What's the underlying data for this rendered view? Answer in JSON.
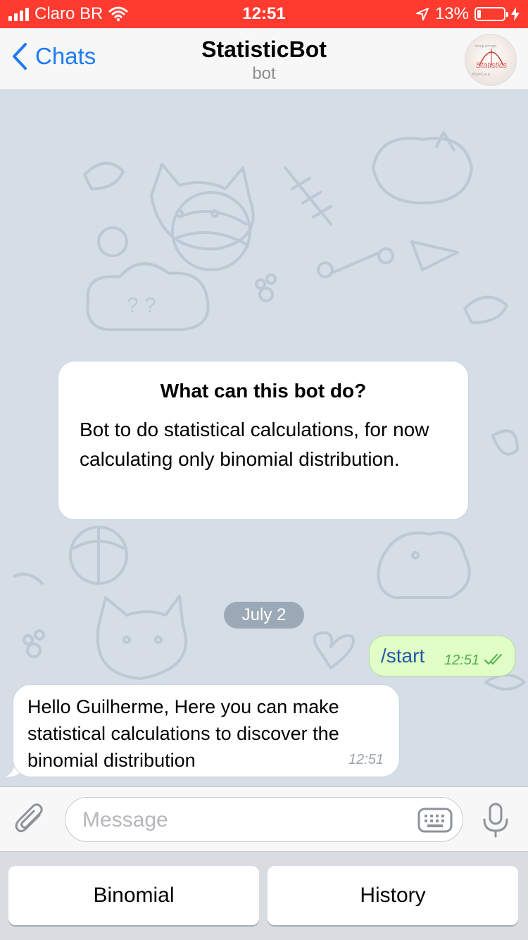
{
  "status_bar": {
    "carrier": "Claro BR",
    "time": "12:51",
    "battery_percent": "13%",
    "battery_level": 0.13,
    "signal_icon": "signal-bars-icon",
    "wifi_icon": "wifi-icon",
    "location_icon": "location-arrow-icon",
    "charging_icon": "charging-bolt-icon"
  },
  "nav": {
    "back_label": "Chats",
    "title": "StatisticBot",
    "subtitle": "bot",
    "avatar_text": "Statistics"
  },
  "info_card": {
    "title": "What can this bot do?",
    "body": "Bot to do statistical calculations, for now calculating only binomial distribution."
  },
  "date_separator": "July 2",
  "messages": [
    {
      "direction": "outgoing",
      "text": "/start",
      "time": "12:51",
      "status": "read"
    },
    {
      "direction": "incoming",
      "text": "Hello Guilherme, Here you can make statistical calculations to discover the binomial distribution",
      "time": "12:51"
    }
  ],
  "input": {
    "placeholder": "Message",
    "value": ""
  },
  "reply_keyboard": {
    "buttons": [
      "Binomial",
      "History"
    ]
  },
  "colors": {
    "status_bar": "#ff3b30",
    "accent": "#1d7cf2",
    "outgoing_bubble": "#e1fec6",
    "chat_background": "#d5dde6"
  }
}
